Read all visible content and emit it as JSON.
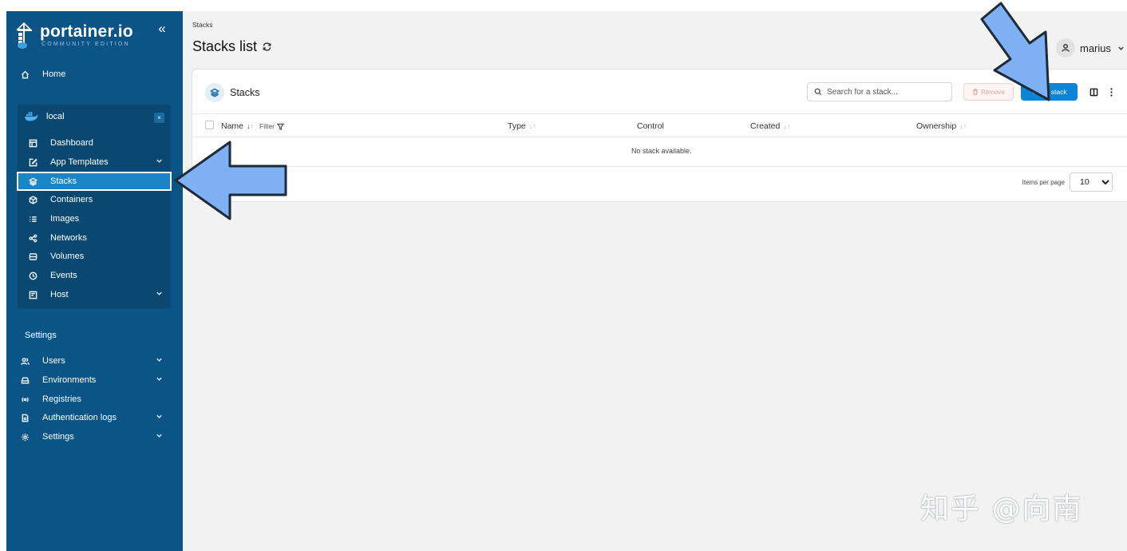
{
  "brand": {
    "name": "portainer.io",
    "edition": "COMMUNITY EDITION",
    "collapse_icon": "«"
  },
  "sidebar": {
    "home": "Home",
    "environment": {
      "name": "local",
      "close_label": "×",
      "items": [
        {
          "label": "Dashboard",
          "icon": "dashboard-icon"
        },
        {
          "label": "App Templates",
          "icon": "edit-icon",
          "has_chevron": true
        },
        {
          "label": "Stacks",
          "icon": "layers-icon",
          "active": true
        },
        {
          "label": "Containers",
          "icon": "box-icon"
        },
        {
          "label": "Images",
          "icon": "list-icon"
        },
        {
          "label": "Networks",
          "icon": "share-icon"
        },
        {
          "label": "Volumes",
          "icon": "database-icon"
        },
        {
          "label": "Events",
          "icon": "clock-icon"
        },
        {
          "label": "Host",
          "icon": "server-icon",
          "has_chevron": true
        }
      ]
    },
    "settings_title": "Settings",
    "settings_items": [
      {
        "label": "Users",
        "icon": "users-icon",
        "has_chevron": true
      },
      {
        "label": "Environments",
        "icon": "hdd-icon",
        "has_chevron": true
      },
      {
        "label": "Registries",
        "icon": "radio-icon"
      },
      {
        "label": "Authentication logs",
        "icon": "file-icon",
        "has_chevron": true
      },
      {
        "label": "Settings",
        "icon": "gear-icon",
        "has_chevron": true
      }
    ]
  },
  "header": {
    "breadcrumb": "Stacks",
    "title": "Stacks list",
    "user": "marius"
  },
  "card": {
    "title": "Stacks",
    "search_placeholder": "Search for a stack...",
    "remove_label": "Remove",
    "add_label": "+ Add stack",
    "columns": {
      "name": "Name",
      "filter": "Filter",
      "type": "Type",
      "control": "Control",
      "created": "Created",
      "ownership": "Ownership"
    },
    "empty_message": "No stack available.",
    "items_per_page_label": "Items per page",
    "items_per_page": "10"
  },
  "watermark": "知乎 @向南",
  "colors": {
    "sidebar_bg": "#0b5485",
    "env_bg": "#0a4771",
    "active_item": "#1a86c7",
    "primary_button": "#0b84d6",
    "annotation_arrow": "#7fb0f4"
  }
}
